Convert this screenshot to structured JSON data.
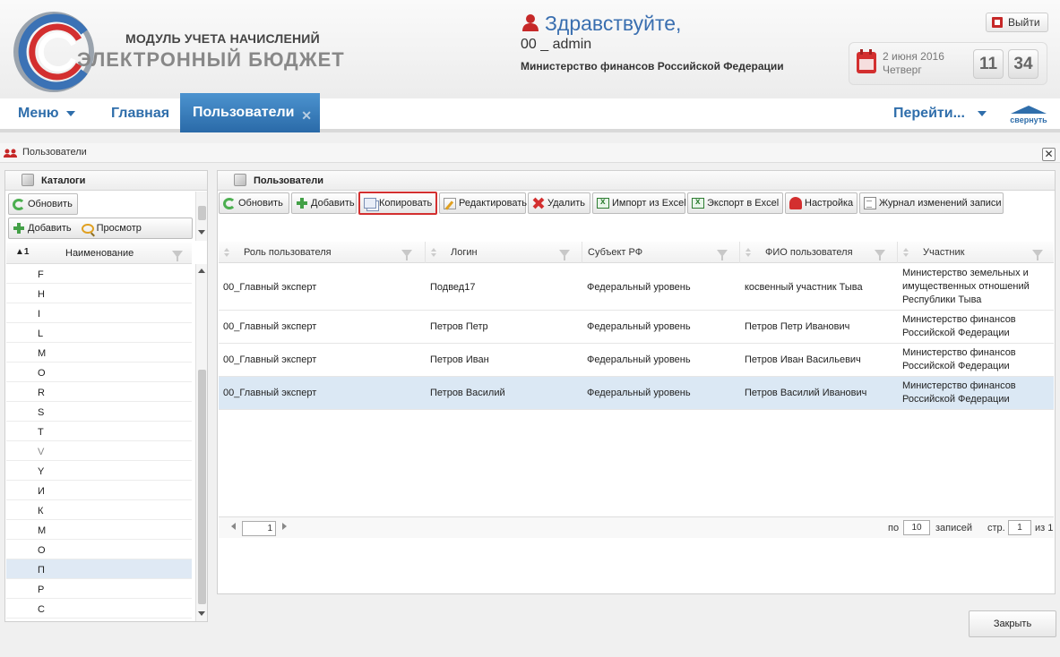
{
  "header": {
    "brand_line1": "МОДУЛЬ УЧЕТА НАЧИСЛЕНИЙ",
    "brand_line2": "ЭЛЕКТРОННЫЙ БЮДЖЕТ",
    "greeting": "Здравствуйте,",
    "username": "00 _ admin",
    "organization": "Министерство финансов Российской Федерации",
    "logout_label": "Выйти",
    "date_line1": "2 июня 2016",
    "date_line2": "Четверг",
    "hour": "11",
    "minute": "34"
  },
  "nav": {
    "menu_label": "Меню",
    "home_label": "Главная",
    "active_tab_label": "Пользователи",
    "goto_label": "Перейти...",
    "collapse_label": "свернуть"
  },
  "page": {
    "title": "Пользователи"
  },
  "catalogs": {
    "title": "Каталоги",
    "refresh_label": "Обновить",
    "add_label": "Добавить",
    "view_label": "Просмотр",
    "sort_marker": "▲1",
    "column_header": "Наименование",
    "items": [
      "F",
      "H",
      "I",
      "L",
      "M",
      "O",
      "R",
      "S",
      "T",
      "V",
      "Y",
      "И",
      "К",
      "М",
      "О",
      "П",
      "Р",
      "С"
    ],
    "selected_index": 15
  },
  "users": {
    "title": "Пользователи",
    "toolbar": {
      "refresh": "Обновить",
      "add": "Добавить",
      "copy": "Копировать",
      "edit": "Редактировать",
      "delete": "Удалить",
      "import_excel": "Импорт из Excel",
      "export_excel": "Экспорт в Excel",
      "settings": "Настройка",
      "change_log": "Журнал изменений записи"
    },
    "columns": [
      "Роль пользователя",
      "Логин",
      "Субъект РФ",
      "ФИО пользователя",
      "Участник"
    ],
    "rows": [
      {
        "role": "00_Главный эксперт",
        "login": "Подвед17",
        "subject": "Федеральный уровень",
        "fio": "косвенный участник Тыва",
        "participant": "Министерство земельных и имущественных отношений Республики Тыва"
      },
      {
        "role": "00_Главный эксперт",
        "login": "Петров Петр",
        "subject": "Федеральный уровень",
        "fio": "Петров Петр Иванович",
        "participant": "Министерство финансов Российской Федерации"
      },
      {
        "role": "00_Главный эксперт",
        "login": "Петров Иван",
        "subject": "Федеральный уровень",
        "fio": "Петров Иван Васильевич",
        "participant": "Министерство финансов Российской Федерации"
      },
      {
        "role": "00_Главный эксперт",
        "login": "Петров Василий",
        "subject": "Федеральный уровень",
        "fio": "Петров Василий Иванович",
        "participant": "Министерство финансов Российской Федерации"
      }
    ],
    "selected_row": 3,
    "pager": {
      "page_value": "1",
      "per_label": "по",
      "per_value": "10",
      "records_label": "записей",
      "page_label": "стр.",
      "page_current": "1",
      "of_label": "из 1"
    }
  },
  "footer": {
    "close_label": "Закрыть"
  },
  "colors": {
    "accent": "#2f6eab",
    "active_tab": "#3a80bf",
    "selected_row": "#dbe8f4",
    "highlight_border": "#d32f2f"
  }
}
